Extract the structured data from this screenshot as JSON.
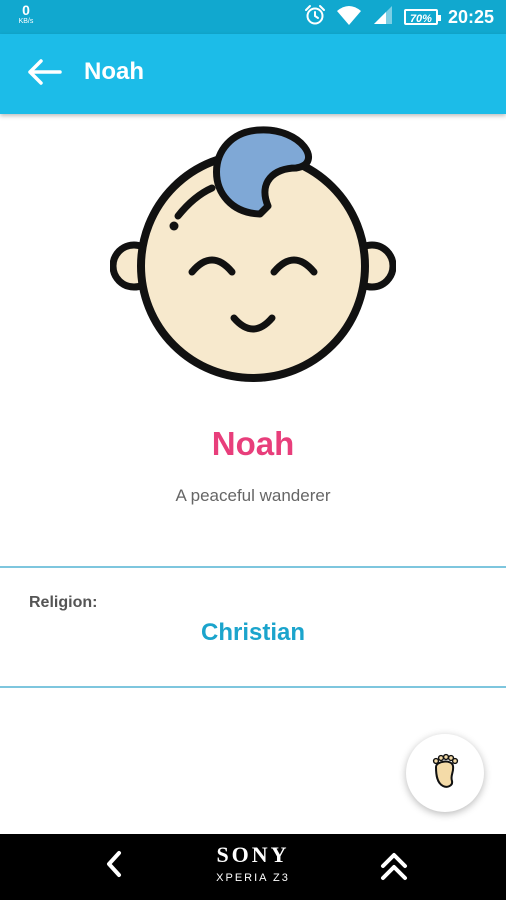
{
  "status_bar": {
    "net_speed": "0",
    "net_unit": "KB/s",
    "battery": "70%",
    "time": "20:25"
  },
  "app_bar": {
    "title": "Noah"
  },
  "profile": {
    "name": "Noah",
    "meaning": "A peaceful wanderer"
  },
  "details": {
    "religion_label": "Religion:",
    "religion_value": "Christian"
  },
  "nav_bar": {
    "brand": "SONY",
    "model": "XPERIA Z3"
  },
  "colors": {
    "status_bar": "#11a8cf",
    "app_bar": "#1cbce8",
    "name": "#e83e7b",
    "accent": "#1ba4cc",
    "divider": "#7ec6de"
  },
  "icons": [
    "back-arrow-icon",
    "alarm-icon",
    "wifi-icon",
    "signal-icon",
    "battery-icon",
    "baby-face-icon",
    "baby-foot-icon",
    "nav-back-icon",
    "nav-up-icon"
  ]
}
